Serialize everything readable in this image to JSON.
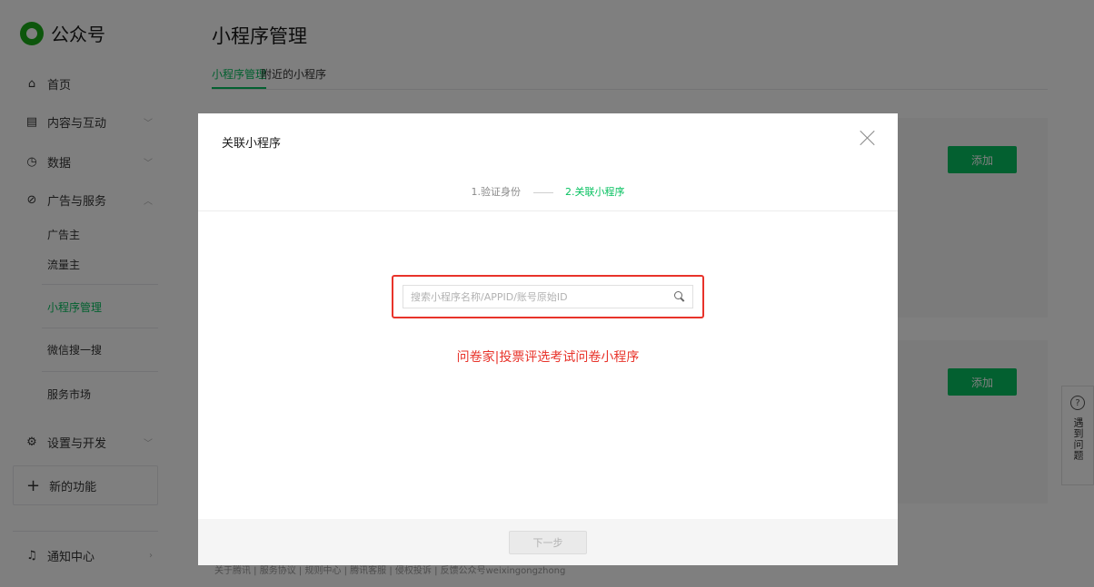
{
  "app": {
    "name": "公众号"
  },
  "sidebar": {
    "home": "首页",
    "content": "内容与互动",
    "data": "数据",
    "ads": "广告与服务",
    "ads_sub": [
      "广告主",
      "流量主",
      "小程序管理",
      "微信搜一搜",
      "服务市场"
    ],
    "settings": "设置与开发",
    "new_feature": "新的功能",
    "notice": "通知中心"
  },
  "page": {
    "title": "小程序管理",
    "tabs": [
      "小程序管理",
      "附近的小程序"
    ],
    "add_label": "添加",
    "footer": "关于腾讯  |  服务协议  |  规则中心  |  腾讯客服  |  侵权投诉  |  反馈公众号weixingongzhong"
  },
  "help": {
    "label": "遇到问题"
  },
  "modal": {
    "title": "关联小程序",
    "step1": "1.验证身份",
    "step2": "2.关联小程序",
    "search_placeholder": "搜索小程序名称/APPID/账号原始ID",
    "annotation": "问卷家|投票评选考试问卷小程序",
    "next": "下一步"
  },
  "colors": {
    "brand": "#07c160",
    "highlight": "#e8332a"
  }
}
